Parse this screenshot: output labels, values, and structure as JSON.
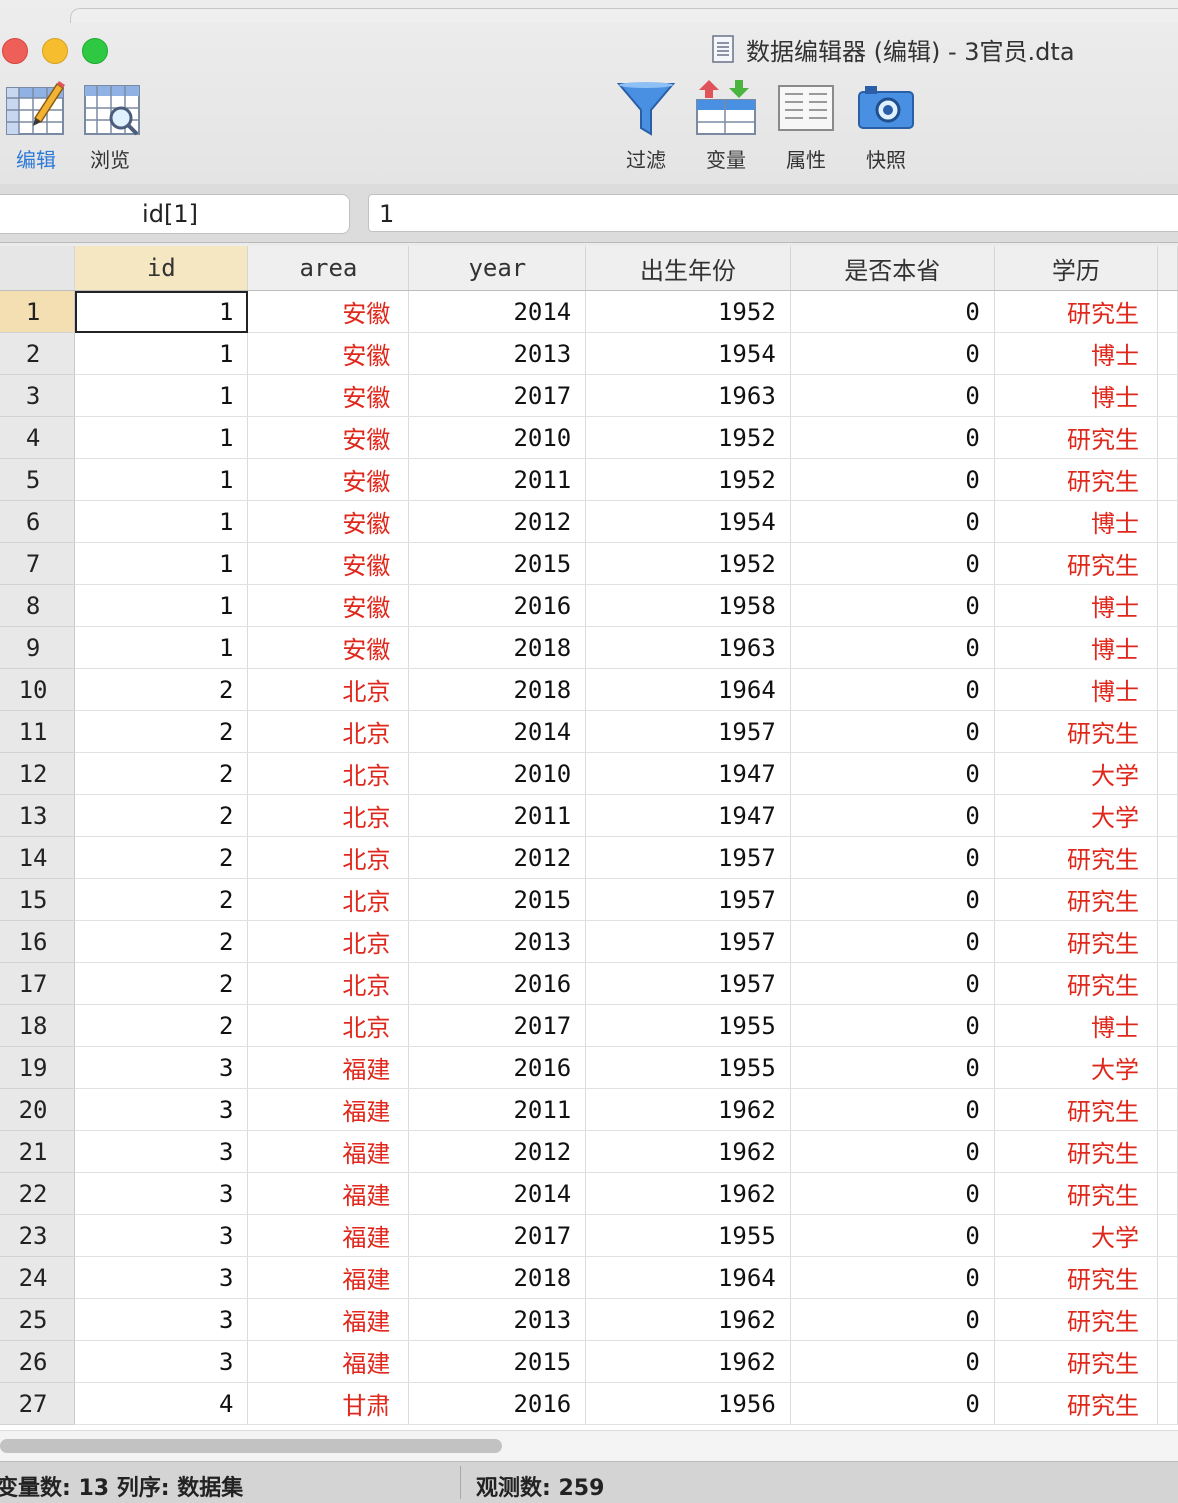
{
  "window": {
    "title": "数据编辑器 (编辑) - 3官员.dta"
  },
  "toolbar": {
    "edit_label": "编辑",
    "browse_label": "浏览",
    "filter_label": "过滤",
    "variables_label": "变量",
    "properties_label": "属性",
    "snapshot_label": "快照"
  },
  "refbar": {
    "cell_name": "id[1]",
    "cell_value": "1"
  },
  "table": {
    "columns": [
      "id",
      "area",
      "year",
      "出生年份",
      "是否本省",
      "学历"
    ],
    "rows": [
      [
        "1",
        "1",
        "安徽",
        "2014",
        "1952",
        "0",
        "研究生"
      ],
      [
        "2",
        "1",
        "安徽",
        "2013",
        "1954",
        "0",
        "博士"
      ],
      [
        "3",
        "1",
        "安徽",
        "2017",
        "1963",
        "0",
        "博士"
      ],
      [
        "4",
        "1",
        "安徽",
        "2010",
        "1952",
        "0",
        "研究生"
      ],
      [
        "5",
        "1",
        "安徽",
        "2011",
        "1952",
        "0",
        "研究生"
      ],
      [
        "6",
        "1",
        "安徽",
        "2012",
        "1954",
        "0",
        "博士"
      ],
      [
        "7",
        "1",
        "安徽",
        "2015",
        "1952",
        "0",
        "研究生"
      ],
      [
        "8",
        "1",
        "安徽",
        "2016",
        "1958",
        "0",
        "博士"
      ],
      [
        "9",
        "1",
        "安徽",
        "2018",
        "1963",
        "0",
        "博士"
      ],
      [
        "10",
        "2",
        "北京",
        "2018",
        "1964",
        "0",
        "博士"
      ],
      [
        "11",
        "2",
        "北京",
        "2014",
        "1957",
        "0",
        "研究生"
      ],
      [
        "12",
        "2",
        "北京",
        "2010",
        "1947",
        "0",
        "大学"
      ],
      [
        "13",
        "2",
        "北京",
        "2011",
        "1947",
        "0",
        "大学"
      ],
      [
        "14",
        "2",
        "北京",
        "2012",
        "1957",
        "0",
        "研究生"
      ],
      [
        "15",
        "2",
        "北京",
        "2015",
        "1957",
        "0",
        "研究生"
      ],
      [
        "16",
        "2",
        "北京",
        "2013",
        "1957",
        "0",
        "研究生"
      ],
      [
        "17",
        "2",
        "北京",
        "2016",
        "1957",
        "0",
        "研究生"
      ],
      [
        "18",
        "2",
        "北京",
        "2017",
        "1955",
        "0",
        "博士"
      ],
      [
        "19",
        "3",
        "福建",
        "2016",
        "1955",
        "0",
        "大学"
      ],
      [
        "20",
        "3",
        "福建",
        "2011",
        "1962",
        "0",
        "研究生"
      ],
      [
        "21",
        "3",
        "福建",
        "2012",
        "1962",
        "0",
        "研究生"
      ],
      [
        "22",
        "3",
        "福建",
        "2014",
        "1962",
        "0",
        "研究生"
      ],
      [
        "23",
        "3",
        "福建",
        "2017",
        "1955",
        "0",
        "大学"
      ],
      [
        "24",
        "3",
        "福建",
        "2018",
        "1964",
        "0",
        "研究生"
      ],
      [
        "25",
        "3",
        "福建",
        "2013",
        "1962",
        "0",
        "研究生"
      ],
      [
        "26",
        "3",
        "福建",
        "2015",
        "1962",
        "0",
        "研究生"
      ],
      [
        "27",
        "4",
        "甘肃",
        "2016",
        "1956",
        "0",
        "研究生"
      ]
    ]
  },
  "status": {
    "left_text": "变量数: 13  列序: 数据集",
    "right_text": "观测数: 259"
  },
  "colors": {
    "string_value": "#e0271b",
    "selected_header": "#f6e7c3",
    "active_tool": "#2f7ad8"
  }
}
